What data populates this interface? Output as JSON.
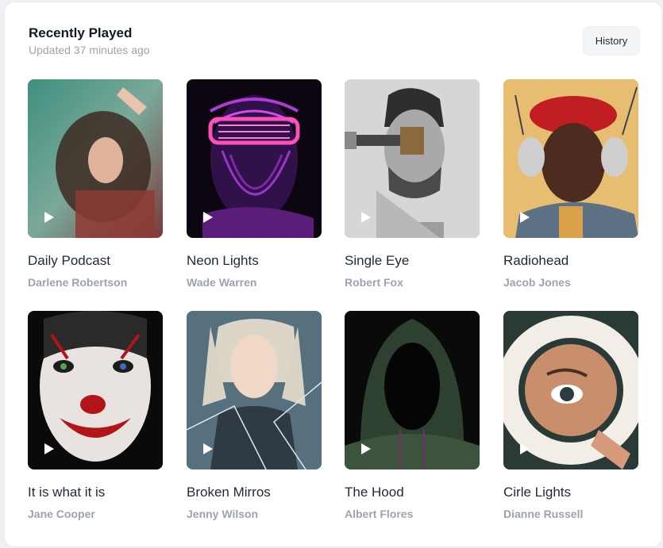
{
  "header": {
    "title": "Recently Played",
    "subtitle": "Updated 37 minutes ago",
    "history_label": "History"
  },
  "items": [
    {
      "title": "Daily Podcast",
      "artist": "Darlene Robertson"
    },
    {
      "title": "Neon Lights",
      "artist": "Wade Warren"
    },
    {
      "title": "Single Eye",
      "artist": "Robert Fox"
    },
    {
      "title": "Radiohead",
      "artist": "Jacob Jones"
    },
    {
      "title": "It is what it is",
      "artist": "Jane Cooper"
    },
    {
      "title": "Broken Mirros",
      "artist": "Jenny Wilson"
    },
    {
      "title": "The Hood",
      "artist": "Albert Flores"
    },
    {
      "title": "Cirle Lights",
      "artist": "Dianne Russell"
    }
  ],
  "icons": {
    "play": "play-icon"
  }
}
